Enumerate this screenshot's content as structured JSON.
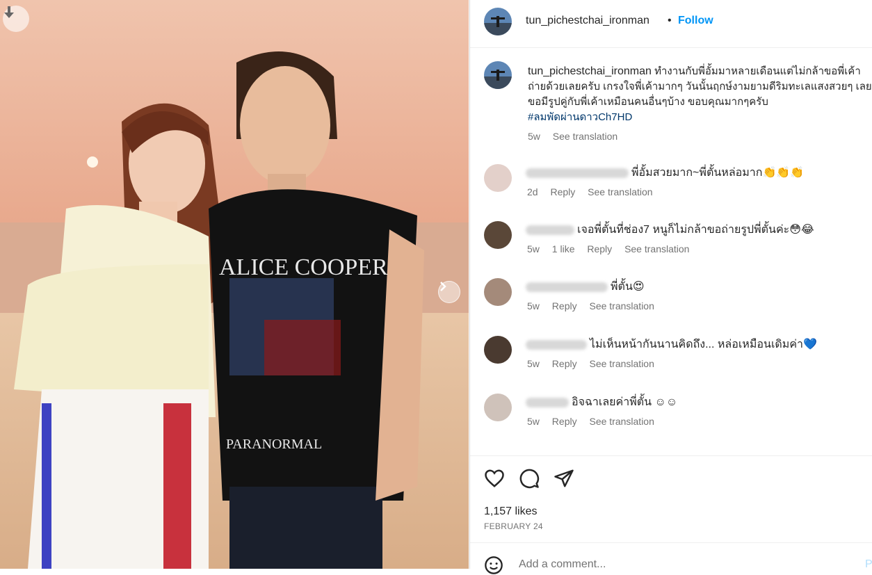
{
  "post": {
    "username": "tun_pichestchai_ironman",
    "dot": "•",
    "follow_label": "Follow",
    "shirt_text_top": "ALICE COOPER",
    "shirt_text_bottom": "PARANORMAL"
  },
  "caption": {
    "username": "tun_pichestchai_ironman",
    "text": "ทำงานกับพี่อั้มมาหลายเดือนแต่ไม่กล้าขอพี่เค้าถ่ายด้วยเลยครับ เกรงใจพี่เค้ามากๆ วันนั้นฤกษ์งามยามดีริมทะเลแสงสวยๆ เลยขอมีรูปคู่กับพี่เค้าเหมือนคนอื่นๆบ้าง ขอบคุณมากๆครับ",
    "hashtag": "#ลมพัดผ่านดาวCh7HD",
    "time": "5w",
    "see_translation": "See translation"
  },
  "comments": [
    {
      "text": "พี่อั้มสวยมาก~พี่ตั้นหล่อมาก👏👏👏",
      "time": "2d",
      "likes": "",
      "reply": "Reply",
      "see_translation": "See translation"
    },
    {
      "text": "เจอพี่ตั้นที่ช่อง7 หนูก็ไม่กล้าขอถ่ายรูปพี่ตั้นค่ะ😳😂",
      "time": "5w",
      "likes": "1 like",
      "reply": "Reply",
      "see_translation": "See translation"
    },
    {
      "text": "พี่ตั้น😍",
      "time": "5w",
      "likes": "",
      "reply": "Reply",
      "see_translation": "See translation"
    },
    {
      "text": "ไม่เห็นหน้ากันนานคิดถึง... หล่อเหมือนเดิมค่า💙",
      "time": "5w",
      "likes": "",
      "reply": "Reply",
      "see_translation": "See translation"
    },
    {
      "text": "อิจฉาเลยค่าพี่ตั้น ☺☺",
      "time": "5w",
      "likes": "",
      "reply": "Reply",
      "see_translation": "See translation"
    }
  ],
  "footer": {
    "likes": "1,157 likes",
    "date": "FEBRUARY 24",
    "add_comment_placeholder": "Add a comment...",
    "post_label": "P"
  },
  "icons": [
    "download-icon",
    "chevron-right-icon",
    "heart-icon",
    "comment-icon",
    "share-icon",
    "emoji-icon"
  ]
}
